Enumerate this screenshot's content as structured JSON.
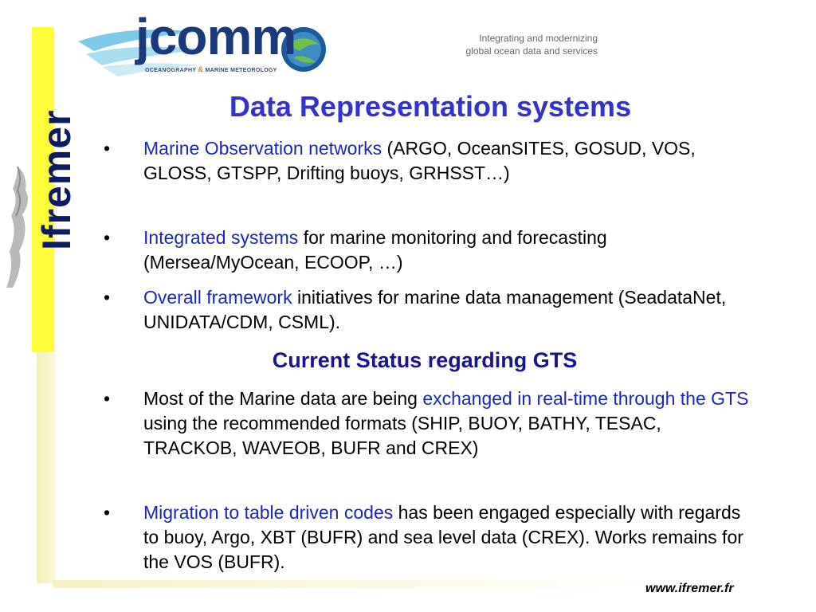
{
  "logo": {
    "word": "jcomm",
    "tagline_left": "OCEANOGRAPHY",
    "tagline_amp": "&",
    "tagline_right": "MARINE METEOROLOGY"
  },
  "tagline": {
    "line1": "Integrating and modernizing",
    "line2": "global ocean data and services"
  },
  "brand": {
    "name": "Ifremer"
  },
  "title": "Data Representation systems",
  "section1": [
    {
      "highlight": "Marine Observation networks",
      "rest": " (ARGO, OceanSITES, GOSUD, VOS, GLOSS, GTSPP, Drifting buoys, GRHSST…)"
    },
    {
      "highlight": "Integrated systems",
      "rest": " for marine monitoring and forecasting (Mersea/MyOcean, ECOOP, …)"
    },
    {
      "highlight": "Overall framework",
      "rest": " initiatives for marine data management (SeadataNet, UNIDATA/CDM, CSML)."
    }
  ],
  "subtitle": "Current Status regarding GTS",
  "section2": [
    {
      "pre": "Most of the Marine data are being ",
      "highlight": "exchanged in real-time through the GTS",
      "rest": " using the recommended formats (SHIP, BUOY, BATHY, TESAC, TRACKOB, WAVEOB, BUFR and CREX)"
    },
    {
      "pre": "",
      "highlight": "Migration to table driven codes",
      "rest": " has been engaged especially with regards to buoy, Argo, XBT (BUFR) and sea level data (CREX). Works remains for the VOS (BUFR)."
    }
  ],
  "bullet_char": "•",
  "footer": {
    "url": "www.ifremer.fr"
  },
  "colors": {
    "title": "#3333cc",
    "subtitle": "#171590",
    "highlight": "#1a28b8",
    "band": "#fffc3a",
    "brand_text": "#0d1a66"
  }
}
